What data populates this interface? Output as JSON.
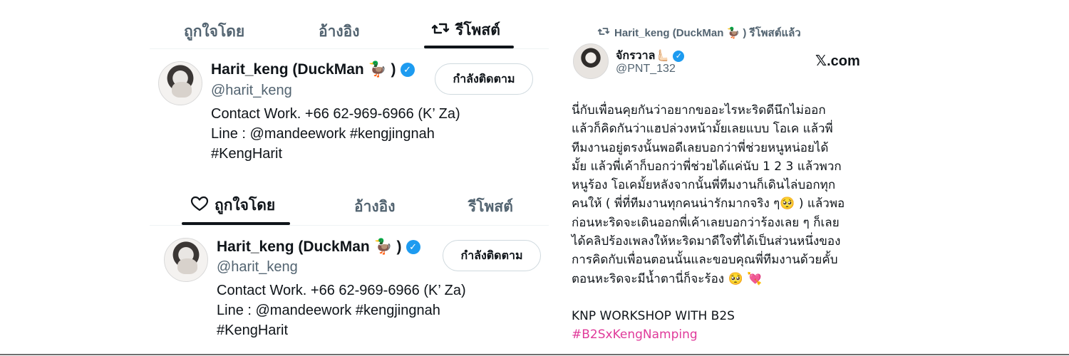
{
  "top_card": {
    "tabs": [
      {
        "label": "ถูกใจโดย",
        "active": false
      },
      {
        "label": "อ้างอิง",
        "active": false
      },
      {
        "label": "รีโพสต์",
        "active": true,
        "icon": "repost-icon"
      }
    ],
    "profile": {
      "display_name": "Harit_keng (DuckMan 🦆 )",
      "handle": "@harit_keng",
      "follow_label": "กำลังติดตาม",
      "bio_lines": [
        "Contact Work. +66 62-969-6966 (K’ Za)",
        "Line : @mandeework #kengjingnah",
        "#KengHarit"
      ]
    }
  },
  "bottom_card": {
    "tabs": [
      {
        "label": "ถูกใจโดย",
        "active": true,
        "icon": "heart-icon"
      },
      {
        "label": "อ้างอิง",
        "active": false
      },
      {
        "label": "รีโพสต์",
        "active": false
      }
    ],
    "profile": {
      "display_name": "Harit_keng (DuckMan 🦆 )",
      "handle": "@harit_keng",
      "follow_label": "กำลังติดตาม",
      "bio_lines": [
        "Contact Work. +66 62-969-6966 (K’ Za)",
        "Line : @mandeework #kengjingnah",
        "#KengHarit"
      ]
    }
  },
  "tweet": {
    "repost_text": "Harit_keng (DuckMan 🦆 ) รีโพสต์แล้ว",
    "author_name": "จักรวาล🫷🏻",
    "author_handle": "@PNT_132",
    "site": "𝕏.com",
    "body_lines": [
      "นี่กับเพื่อนคุยกันว่าอยากขออะไรหะริดดีนึกไม่ออก",
      "แล้วก็คิดกันว่าแฮปล่วงหน้ามั้ยเลยแบบ โอเค แล้วพี่",
      "ทีมงานอยู่ตรงนั้นพอดีเลยบอกว่าพี่ช่วยหนูหน่อยได้",
      "มั้ย แล้วพี่เค้าก็บอกว่าพี่ช่วยได้แค่นับ 1 2 3 แล้วพวก",
      "หนูร้อง โอเคมั้ยหลังจากนั้นพี่ทีมงานก็เดินไล่บอกทุก",
      "คนให้ ( พี่ที่ทีมงานทุกคนน่ารักมากจริง ๆ🥺 ) แล้วพอ",
      "ก่อนหะริดจะเดินออกพี่เค้าเลยบอกว่าร้องเลย ๆ ก็เลย",
      "ได้คลิปร้องเพลงให้หะริดมาดีใจที่ได้เป็นส่วนหนึ่งของ",
      "การคิดกับเพื่อนตอนนั้นและขอบคุณพี่ทีมงานด้วยคั้บ",
      "ตอนหะริดจะมีน้ำตานี่ก็จะร้อง 🥺 💘"
    ],
    "footer_line": "KNP WORKSHOP WITH B2S",
    "hashtag": "#B2SxKengNamping",
    "hashtag_color": "#e03a9a"
  },
  "colors": {
    "verified": "#1d9bf0",
    "secondary_text": "#536471"
  }
}
